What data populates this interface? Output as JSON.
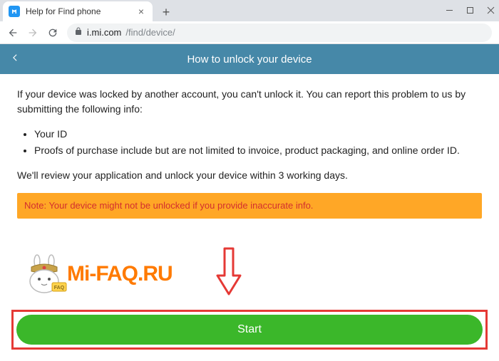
{
  "browser": {
    "tab_title": "Help for Find phone",
    "url_host": "i.mi.com",
    "url_path": "/find/device/"
  },
  "header": {
    "title": "How to unlock your device"
  },
  "content": {
    "intro": "If your device was locked by another account, you can't unlock it. You can report this problem to us by submitting the following info:",
    "list": {
      "item0": "Your ID",
      "item1": "Proofs of purchase include but are not limited to invoice, product packaging, and online order ID."
    },
    "review": "We'll review your application and unlock your device within 3 working days.",
    "warning": "Note: Your device might not be unlocked if you provide inaccurate info."
  },
  "watermark": {
    "logo_text": "Mi-FAQ.RU",
    "faq_badge": "FAQ"
  },
  "action": {
    "start_label": "Start"
  }
}
